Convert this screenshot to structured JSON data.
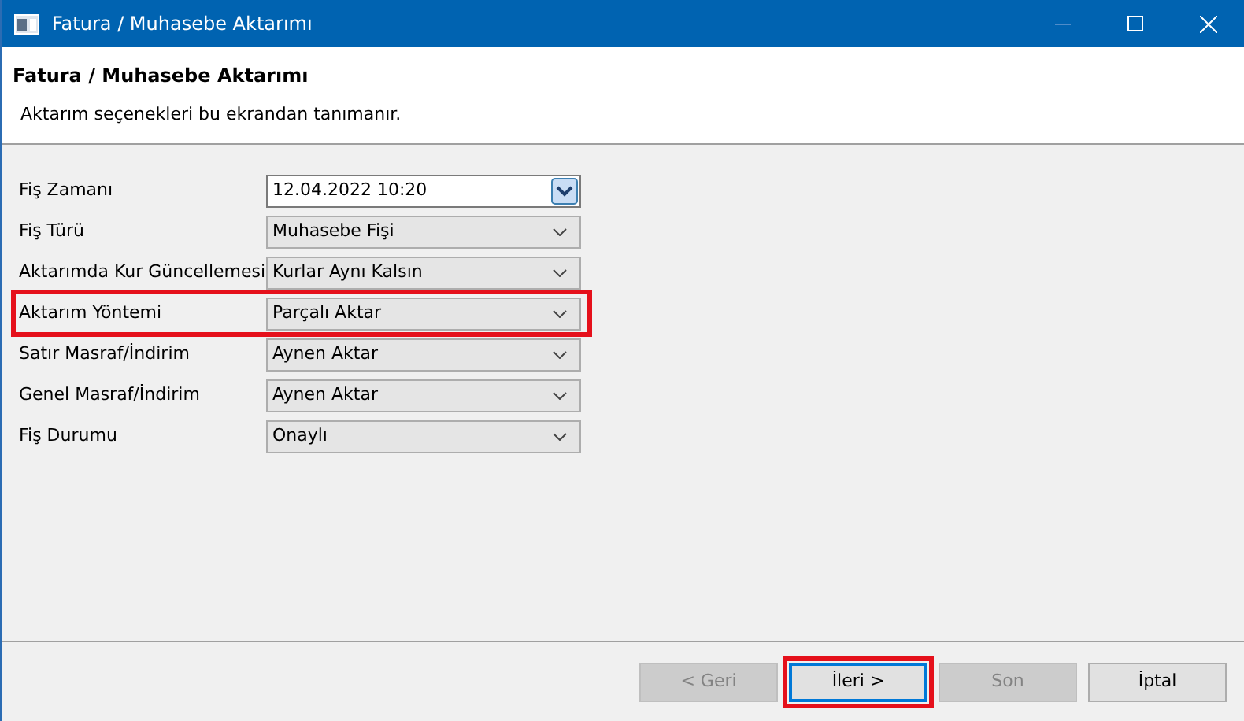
{
  "window": {
    "title": "Fatura / Muhasebe Aktarımı",
    "minimize_disabled": true
  },
  "header": {
    "title": "Fatura / Muhasebe Aktarımı",
    "subtitle": "Aktarım seçenekleri bu ekrandan tanımanır."
  },
  "fields": [
    {
      "label": "Fiş Zamanı",
      "value": "12.04.2022 10:20",
      "kind": "date",
      "highlighted": false
    },
    {
      "label": "Fiş Türü",
      "value": "Muhasebe Fişi",
      "kind": "combo",
      "highlighted": false
    },
    {
      "label": "Aktarımda Kur Güncellemesi",
      "value": "Kurlar Aynı Kalsın",
      "kind": "combo",
      "highlighted": false
    },
    {
      "label": "Aktarım Yöntemi",
      "value": "Parçalı Aktar",
      "kind": "combo",
      "highlighted": true
    },
    {
      "label": "Satır Masraf/İndirim",
      "value": "Aynen Aktar",
      "kind": "combo",
      "highlighted": false
    },
    {
      "label": "Genel Masraf/İndirim",
      "value": "Aynen Aktar",
      "kind": "combo",
      "highlighted": false
    },
    {
      "label": "Fiş Durumu",
      "value": "Onaylı",
      "kind": "combo",
      "highlighted": false
    }
  ],
  "buttons": [
    {
      "label": "< Geri",
      "disabled": true,
      "default": false,
      "highlighted": false
    },
    {
      "label": "İleri >",
      "disabled": false,
      "default": true,
      "highlighted": true
    },
    {
      "label": "Son",
      "disabled": true,
      "default": false,
      "highlighted": false
    },
    {
      "label": "İptal",
      "disabled": false,
      "default": false,
      "highlighted": false
    }
  ]
}
